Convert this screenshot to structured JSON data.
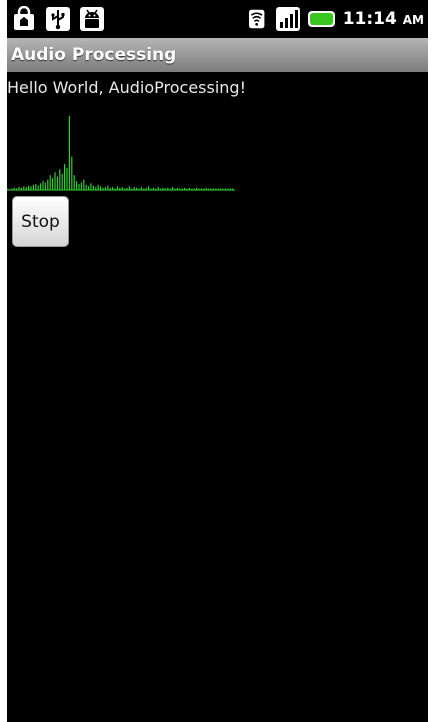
{
  "status_bar": {
    "time": "11:14",
    "ampm": "AM",
    "left_icons": [
      "shopping-bag-icon",
      "usb-icon",
      "android-icon"
    ],
    "right_icons": [
      "wifi-icon",
      "signal-icon",
      "battery-icon"
    ],
    "battery_color": "#39c71f"
  },
  "app": {
    "title": "Audio Processing",
    "message": "Hello World, AudioProcessing!",
    "stop_label": "Stop"
  },
  "spectrum": {
    "line_color": "#2fd32f",
    "bins": [
      0.02,
      0.01,
      0.02,
      0.03,
      0.02,
      0.04,
      0.03,
      0.05,
      0.04,
      0.06,
      0.05,
      0.07,
      0.08,
      0.06,
      0.09,
      0.12,
      0.1,
      0.14,
      0.2,
      0.16,
      0.24,
      0.18,
      0.28,
      0.22,
      0.35,
      0.3,
      1.0,
      0.45,
      0.2,
      0.12,
      0.08,
      0.1,
      0.14,
      0.07,
      0.05,
      0.09,
      0.06,
      0.04,
      0.07,
      0.05,
      0.03,
      0.04,
      0.06,
      0.03,
      0.04,
      0.02,
      0.05,
      0.03,
      0.04,
      0.02,
      0.03,
      0.05,
      0.02,
      0.04,
      0.03,
      0.02,
      0.04,
      0.02,
      0.03,
      0.05,
      0.02,
      0.03,
      0.02,
      0.04,
      0.02,
      0.03,
      0.02,
      0.03,
      0.02,
      0.04,
      0.02,
      0.03,
      0.02,
      0.02,
      0.03,
      0.02,
      0.03,
      0.02,
      0.02,
      0.03,
      0.02,
      0.02,
      0.02,
      0.03,
      0.02,
      0.02,
      0.02,
      0.02,
      0.02,
      0.02,
      0.02,
      0.02,
      0.02,
      0.02,
      0.02
    ]
  }
}
